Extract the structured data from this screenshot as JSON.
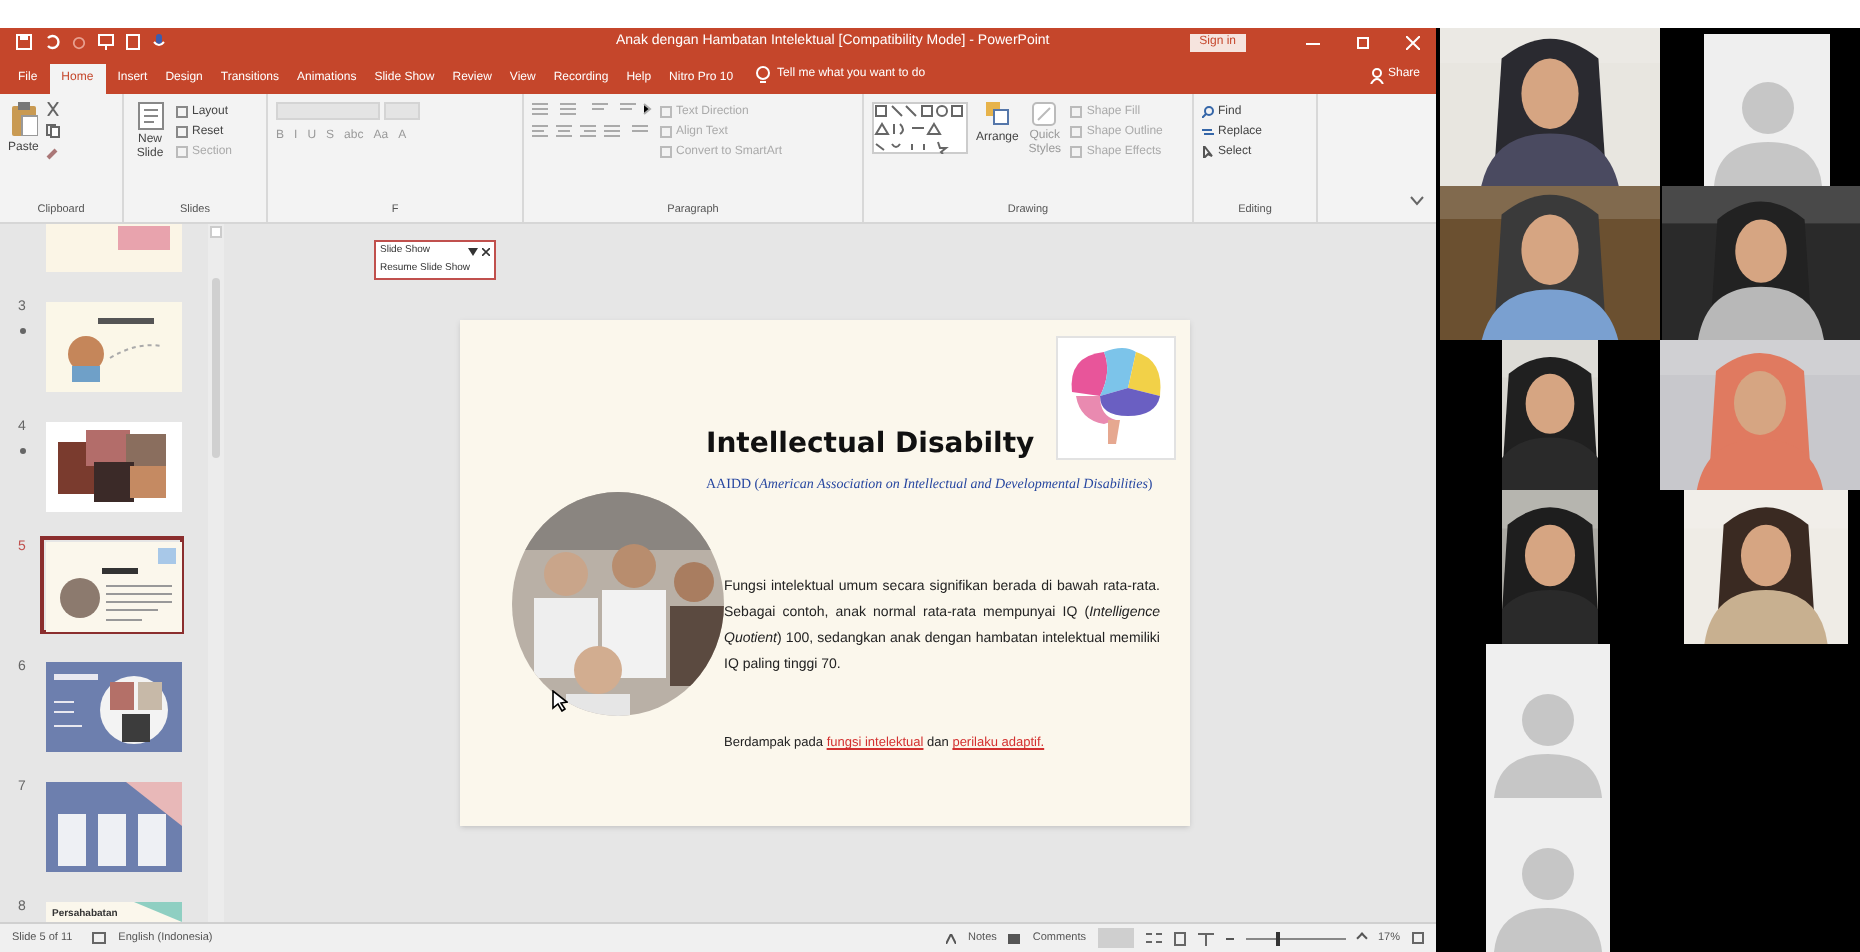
{
  "window": {
    "title": "Anak dengan Hambatan Intelektual [Compatibility Mode] - PowerPoint",
    "sign_in": "Sign in"
  },
  "tabs": [
    {
      "label": "File",
      "selected": false
    },
    {
      "label": "Home",
      "selected": true
    },
    {
      "label": "Insert",
      "selected": false
    },
    {
      "label": "Design",
      "selected": false
    },
    {
      "label": "Transitions",
      "selected": false
    },
    {
      "label": "Animations",
      "selected": false
    },
    {
      "label": "Slide Show",
      "selected": false
    },
    {
      "label": "Review",
      "selected": false
    },
    {
      "label": "View",
      "selected": false
    },
    {
      "label": "Recording",
      "selected": false
    },
    {
      "label": "Help",
      "selected": false
    },
    {
      "label": "Nitro Pro 10",
      "selected": false
    }
  ],
  "tell_me": "Tell me what you want to do",
  "share": "Share",
  "ribbon": {
    "clipboard": {
      "paste": "Paste",
      "label": "Clipboard"
    },
    "slides": {
      "new_slide": "New Slide",
      "layout": "Layout",
      "reset": "Reset",
      "section": "Section",
      "label": "Slides"
    },
    "font": {
      "buttons": [
        "B",
        "I",
        "U",
        "S",
        "abc",
        "Aa",
        "A"
      ],
      "label": "F"
    },
    "paragraph": {
      "text_direction": "Text Direction",
      "align_text": "Align Text",
      "convert": "Convert to SmartArt",
      "label": "Paragraph"
    },
    "drawing": {
      "arrange": "Arrange",
      "quick_styles": "Quick Styles",
      "shape_fill": "Shape Fill",
      "shape_outline": "Shape Outline",
      "shape_effects": "Shape Effects",
      "label": "Drawing"
    },
    "editing": {
      "find": "Find",
      "replace": "Replace",
      "select": "Select",
      "label": "Editing"
    }
  },
  "slideshow_popup": {
    "title": "Slide Show",
    "resume": "Resume Slide Show"
  },
  "thumbnails": [
    {
      "kind": "text",
      "animated": false,
      "selected": false
    },
    {
      "number": "3",
      "kind": "cartoon",
      "animated": true,
      "selected": false
    },
    {
      "number": "4",
      "kind": "collage",
      "animated": true,
      "selected": false
    },
    {
      "number": "5",
      "kind": "current",
      "animated": false,
      "selected": true
    },
    {
      "number": "6",
      "kind": "blue",
      "animated": false,
      "selected": false
    },
    {
      "number": "7",
      "kind": "columns",
      "animated": false,
      "selected": false
    },
    {
      "number": "8",
      "kind": "title",
      "title": "Persahabatan",
      "animated": false,
      "selected": false
    }
  ],
  "slide": {
    "title": "Intellectual Disabilty",
    "source": "AAIDD (*American Association on Intellectual and Developmental Disabilities*)",
    "body": "Fungsi intelektual umum secara signifikan berada di bawah rata-rata. Sebagai contoh, anak normal rata-rata mempunyai IQ (*Intelligence Quotient*) 100, sedangkan anak dengan hambatan intelektual memiliki IQ paling tinggi 70.",
    "footer": {
      "text_1": "Berdampak pada",
      "link_1": "fungsi intelektual",
      "text_2": "dan",
      "link_2": "perilaku adaptif."
    }
  },
  "status_bar": {
    "slide": "Slide 5 of 11",
    "language": "English (Indonesia)",
    "notes": "Notes",
    "comments": "Comments",
    "zoom": "17%",
    "zoom_slider": {
      "level": 0.3
    }
  },
  "participants": [
    {
      "kind": "video"
    },
    {
      "kind": "avatar"
    },
    {
      "kind": "video"
    },
    {
      "kind": "video"
    },
    {
      "kind": "video"
    },
    {
      "kind": "video"
    },
    {
      "kind": "video"
    },
    {
      "kind": "video"
    },
    {
      "kind": "avatar"
    },
    {
      "kind": "avatar"
    }
  ]
}
